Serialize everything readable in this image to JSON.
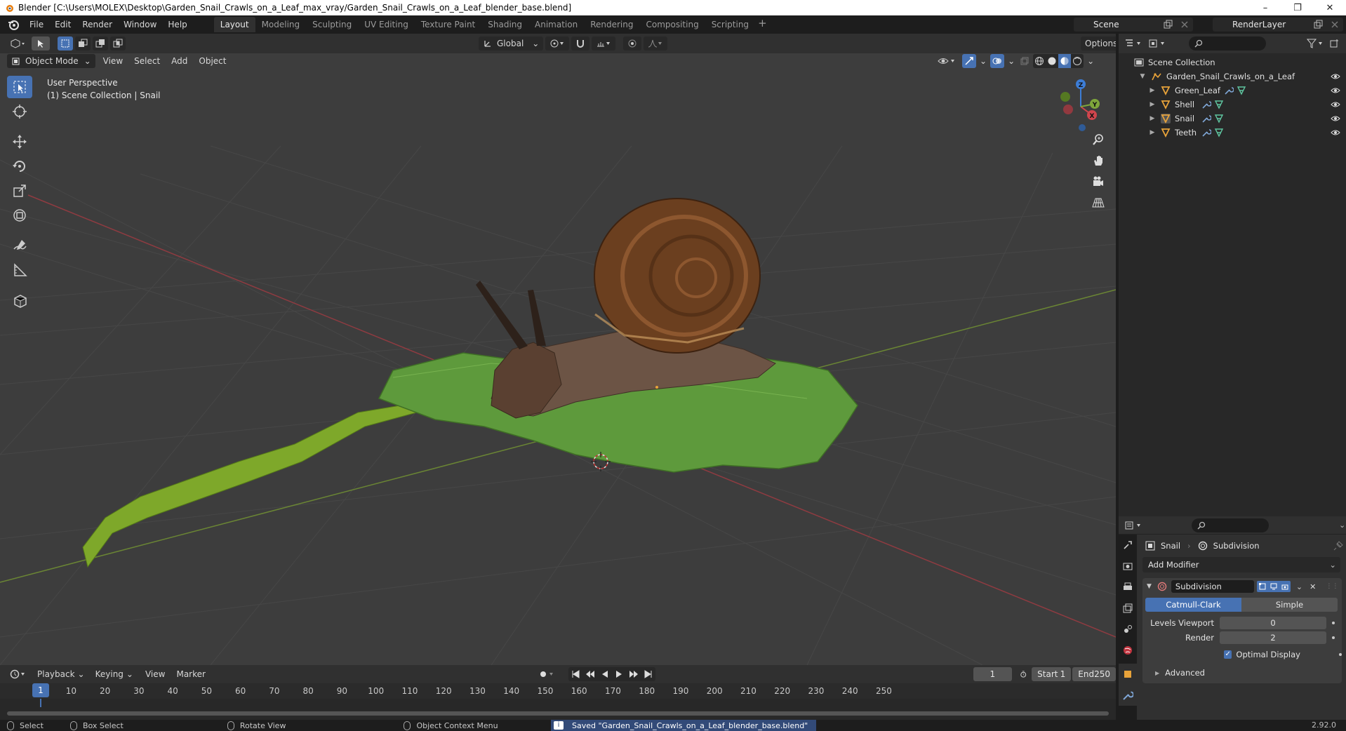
{
  "window": {
    "title": "Blender [C:\\Users\\MOLEX\\Desktop\\Garden_Snail_Crawls_on_a_Leaf_max_vray/Garden_Snail_Crawls_on_a_Leaf_blender_base.blend]",
    "minimize": "–",
    "maximize": "❐",
    "close": "✕"
  },
  "menus": [
    "File",
    "Edit",
    "Render",
    "Window",
    "Help"
  ],
  "workspaces": [
    "Layout",
    "Modeling",
    "Sculpting",
    "UV Editing",
    "Texture Paint",
    "Shading",
    "Animation",
    "Rendering",
    "Compositing",
    "Scripting"
  ],
  "workspace_add": "+",
  "scene": "Scene",
  "render_layer": "RenderLayer",
  "viewport": {
    "transform_orientation": "Global",
    "options": "Options",
    "mode": "Object Mode",
    "menus": [
      "View",
      "Select",
      "Add",
      "Object"
    ],
    "overlay_line1": "User Perspective",
    "overlay_line2": "(1) Scene Collection | Snail",
    "gizmo": {
      "x": "X",
      "y": "Y",
      "z": "Z"
    }
  },
  "outliner": {
    "root": "Scene Collection",
    "collection": "Garden_Snail_Crawls_on_a_Leaf",
    "objects": [
      "Green_Leaf",
      "Shell",
      "Snail",
      "Teeth"
    ]
  },
  "properties": {
    "object": "Snail",
    "modifier_context": "Subdivision",
    "add_modifier": "Add Modifier",
    "modifier_name": "Subdivision",
    "mode_on": "Catmull-Clark",
    "mode_off": "Simple",
    "levels_viewport_label": "Levels Viewport",
    "levels_viewport": "0",
    "render_label": "Render",
    "render": "2",
    "optimal_display": "Optimal Display",
    "advanced": "Advanced"
  },
  "timeline": {
    "menus": [
      "Playback",
      "Keying",
      "View",
      "Marker"
    ],
    "current_frame": "1",
    "start_label": "Start",
    "start": "1",
    "end_label": "End",
    "end": "250",
    "ticks": [
      "10",
      "20",
      "30",
      "40",
      "50",
      "60",
      "70",
      "80",
      "90",
      "100",
      "110",
      "120",
      "130",
      "140",
      "150",
      "160",
      "170",
      "180",
      "190",
      "200",
      "210",
      "220",
      "230",
      "240",
      "250"
    ]
  },
  "status": {
    "select": "Select",
    "box_select": "Box Select",
    "rotate_view": "Rotate View",
    "context_menu": "Object Context Menu",
    "message": "Saved \"Garden_Snail_Crawls_on_a_Leaf_blender_base.blend\"",
    "version": "2.92.0"
  },
  "colors": {
    "accent": "#4772b3",
    "viewport_bg": "#3d3d3d",
    "panel_bg": "#303030",
    "x_axis": "#d0454d",
    "y_axis": "#7ea63b",
    "z_axis": "#3d7dd6"
  }
}
